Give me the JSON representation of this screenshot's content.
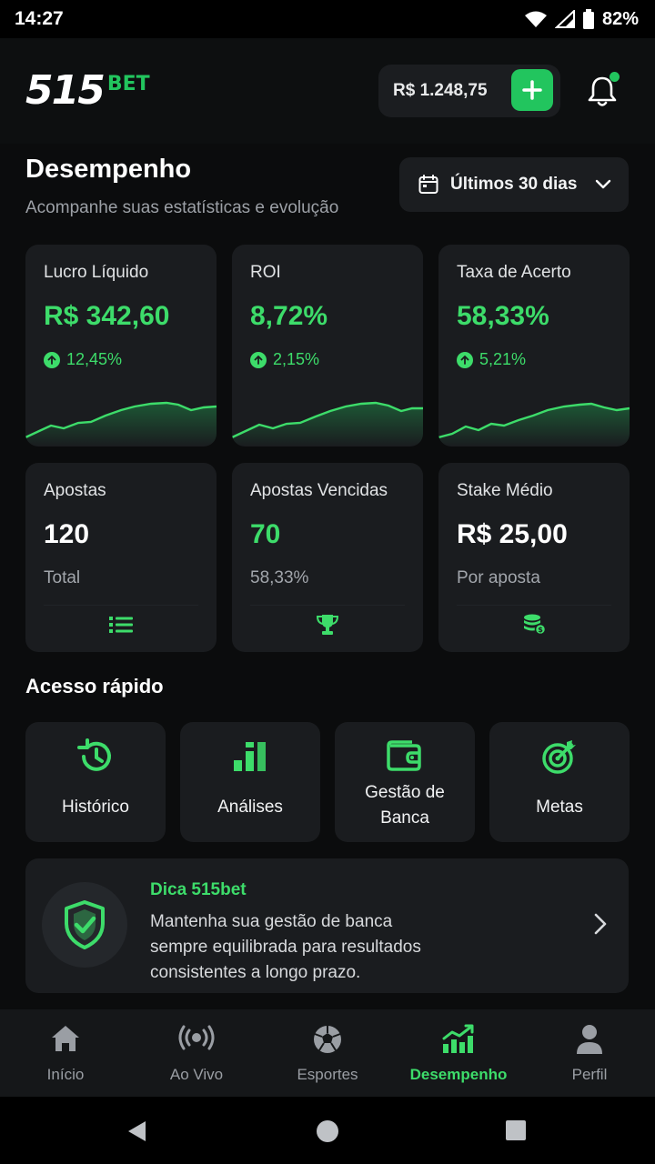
{
  "status_bar": {
    "time": "14:27",
    "battery": "82%"
  },
  "header": {
    "logo_number": "515",
    "logo_suffix": "BET",
    "balance": "R$ 1.248,75"
  },
  "page": {
    "title": "Desempenho",
    "subtitle": "Acompanhe suas estatísticas e evolução",
    "period": "Últimos 30 dias"
  },
  "stats": [
    {
      "label": "Lucro Líquido",
      "value": "R$ 342,60",
      "change": "12,45%"
    },
    {
      "label": "ROI",
      "value": "8,72%",
      "change": "2,15%"
    },
    {
      "label": "Taxa de Acerto",
      "value": "58,33%",
      "change": "5,21%"
    }
  ],
  "counts": [
    {
      "label": "Apostas",
      "value": "120",
      "sub": "Total",
      "icon": "list-icon"
    },
    {
      "label": "Apostas Vencidas",
      "value": "70",
      "sub": "58,33%",
      "icon": "trophy-icon"
    },
    {
      "label": "Stake Médio",
      "value": "R$ 25,00",
      "sub": "Por aposta",
      "icon": "coins-icon"
    }
  ],
  "quick_access": {
    "title": "Acesso rápido",
    "items": [
      {
        "label": "Histórico",
        "icon": "history-icon"
      },
      {
        "label": "Análises",
        "icon": "bar-chart-icon"
      },
      {
        "label_line1": "Gestão de",
        "label_line2": "Banca",
        "icon": "wallet-icon"
      },
      {
        "label": "Metas",
        "icon": "target-icon"
      }
    ]
  },
  "tip": {
    "title": "Dica 515bet",
    "line1": "Mantenha sua gestão de banca",
    "line2": "sempre equilibrada para resultados",
    "line3": "consistentes a longo prazo.",
    "icon": "shield-check-icon"
  },
  "nav": [
    {
      "label": "Início",
      "icon": "home-icon"
    },
    {
      "label": "Ao Vivo",
      "icon": "live-icon"
    },
    {
      "label": "Esportes",
      "icon": "soccer-ball-icon"
    },
    {
      "label": "Desempenho",
      "icon": "trending-chart-icon",
      "active": true
    },
    {
      "label": "Perfil",
      "icon": "user-icon"
    }
  ],
  "colors": {
    "accent": "#22c55e",
    "accent_text": "#3ddc6a",
    "card": "#1a1c1f",
    "background": "#0b0c0d"
  }
}
